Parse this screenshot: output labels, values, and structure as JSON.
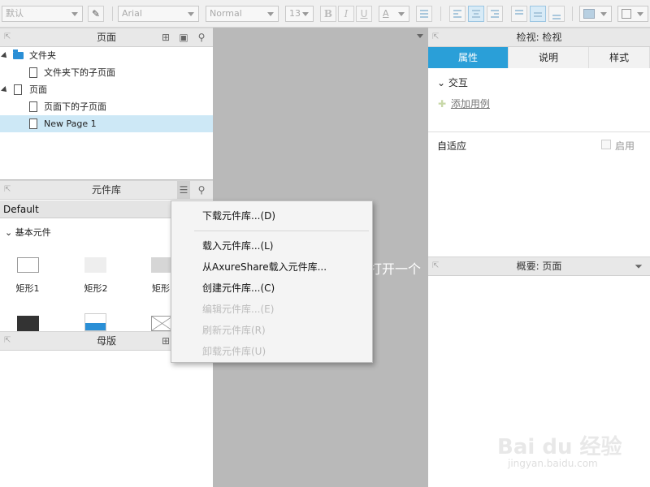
{
  "toolbar": {
    "style_select": "默认",
    "font_select": "Arial",
    "weight_select": "Normal",
    "size_select": "13",
    "bold": "B",
    "italic": "I",
    "underline": "U",
    "font_color": "A"
  },
  "pages_panel": {
    "title": "页面",
    "tree": [
      {
        "label": "文件夹"
      },
      {
        "label": "文件夹下的子页面"
      },
      {
        "label": "页面"
      },
      {
        "label": "页面下的子页面"
      },
      {
        "label": "New Page 1"
      }
    ]
  },
  "library_panel": {
    "title": "元件库",
    "selected_library": "Default",
    "section": "基本元件",
    "items": [
      "矩形1",
      "矩形2",
      "矩形"
    ]
  },
  "masters_panel": {
    "title": "母版"
  },
  "canvas": {
    "partial_text": "打开一个"
  },
  "inspector": {
    "title": "检视: 检视",
    "tabs": [
      "属性",
      "说明",
      "样式"
    ],
    "interaction_label": "交互",
    "add_case": "添加用例",
    "adaptive_label": "自适应",
    "enable_label": "启用"
  },
  "outline_panel": {
    "title": "概要: 页面"
  },
  "context_menu": {
    "items": [
      {
        "label": "下载元件库...(D)",
        "enabled": true
      },
      {
        "label": "载入元件库...(L)",
        "enabled": true
      },
      {
        "label": "从AxureShare载入元件库...",
        "enabled": true
      },
      {
        "label": "创建元件库...(C)",
        "enabled": true
      },
      {
        "label": "编辑元件库...(E)",
        "enabled": false
      },
      {
        "label": "刷新元件库(R)",
        "enabled": false
      },
      {
        "label": "卸载元件库(U)",
        "enabled": false
      }
    ]
  },
  "watermark": {
    "brand": "Bai du 经验",
    "url": "jingyan.baidu.com"
  },
  "colors": {
    "accent": "#2a9fd8",
    "selected_row": "#cde8f6",
    "canvas": "#b9b9b9"
  }
}
